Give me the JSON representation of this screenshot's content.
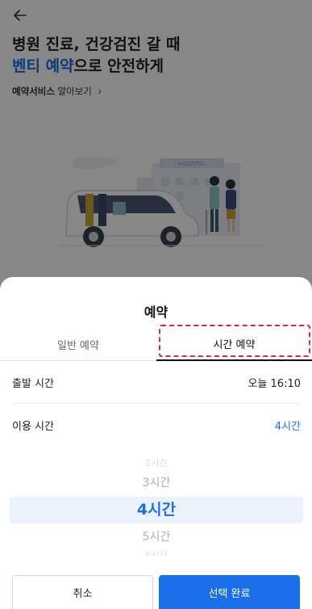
{
  "background": {
    "title_line1": "병원 진료, 건강검진 갈 때",
    "title_line2_accent": "벤티 예약",
    "title_line2_rest": "으로 안전하게",
    "learn_more_strong": "예약서비스",
    "learn_more_rest": "알아보기",
    "learn_more_arrow": "›",
    "hospital_sign": "HOSPITAL"
  },
  "sheet": {
    "title": "예약",
    "tabs": [
      {
        "label": "일반 예약",
        "selected": false
      },
      {
        "label": "시간 예약",
        "selected": true
      }
    ],
    "departure": {
      "label": "출발 시간",
      "value": "오늘 16:10"
    },
    "usage": {
      "label": "이용 시간",
      "value": "4시간"
    },
    "picker_options": [
      "2시간",
      "3시간",
      "4시간",
      "5시간",
      "6시간"
    ],
    "cancel_label": "취소",
    "confirm_label": "선택 완료"
  },
  "colors": {
    "accent": "#1a6fe8",
    "highlight": "#e0282e",
    "overlay": "rgba(0,0,0,0.47)"
  }
}
